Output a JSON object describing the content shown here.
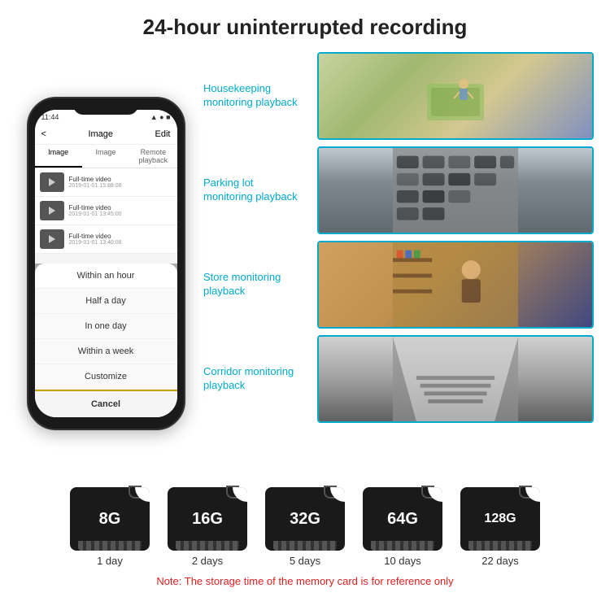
{
  "header": {
    "title": "24-hour uninterrupted recording"
  },
  "phone": {
    "time": "11:44",
    "nav_title": "Image",
    "nav_back": "<",
    "nav_edit": "Edit",
    "tabs": [
      "Image",
      "Image",
      "Remote playback"
    ],
    "list_items": [
      {
        "label": "Full-time video",
        "time": "2019-01-01 15:88:08"
      },
      {
        "label": "Full-time video",
        "time": "2019-01-01 13:45:00"
      },
      {
        "label": "Full-time video",
        "time": "2019-01-01 13:40:08"
      }
    ],
    "dropdown_items": [
      "Within an hour",
      "Half a day",
      "In one day",
      "Within a week",
      "Customize"
    ],
    "cancel_label": "Cancel"
  },
  "monitoring": [
    {
      "label": "Housekeeping\nmonitoring playback",
      "scene": "housekeeping"
    },
    {
      "label": "Parking lot\nmonitoring playback",
      "scene": "parking"
    },
    {
      "label": "Store monitoring\nplayback",
      "scene": "store"
    },
    {
      "label": "Corridor monitoring\nplayback",
      "scene": "corridor"
    }
  ],
  "sd_cards": [
    {
      "size": "8G",
      "days": "1 day"
    },
    {
      "size": "16G",
      "days": "2 days"
    },
    {
      "size": "32G",
      "days": "5 days"
    },
    {
      "size": "64G",
      "days": "10 days"
    },
    {
      "size": "128G",
      "days": "22 days"
    }
  ],
  "note": "Note: The storage time of the memory card is for reference only"
}
